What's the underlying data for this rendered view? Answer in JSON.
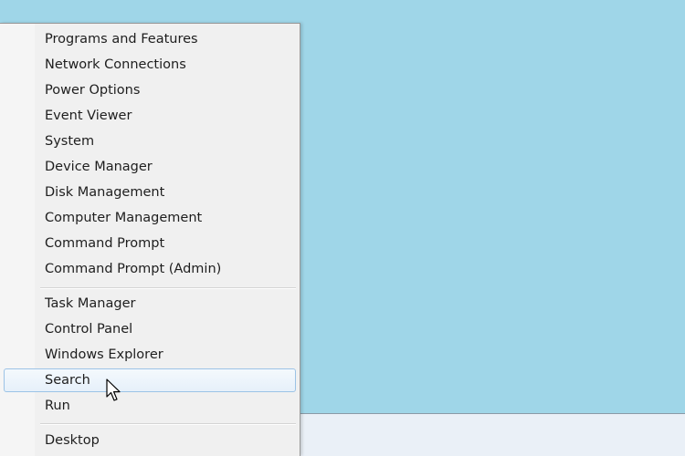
{
  "context_menu": {
    "groups": [
      {
        "items": [
          {
            "label": "Programs and Features"
          },
          {
            "label": "Network Connections"
          },
          {
            "label": "Power Options"
          },
          {
            "label": "Event Viewer"
          },
          {
            "label": "System"
          },
          {
            "label": "Device Manager"
          },
          {
            "label": "Disk Management"
          },
          {
            "label": "Computer Management"
          },
          {
            "label": "Command Prompt"
          },
          {
            "label": "Command Prompt (Admin)"
          }
        ]
      },
      {
        "items": [
          {
            "label": "Task Manager"
          },
          {
            "label": "Control Panel"
          },
          {
            "label": "Windows Explorer"
          },
          {
            "label": "Search"
          },
          {
            "label": "Run"
          }
        ]
      },
      {
        "items": [
          {
            "label": "Desktop"
          }
        ]
      }
    ],
    "highlighted_item": "Search"
  },
  "icons": {
    "cursor": "mouse-pointer-icon"
  },
  "colors": {
    "desktop": "#9fd6e8",
    "menu_background": "#f0f0f0",
    "highlight_border": "#9cc3e6",
    "taskbar": "#eaf0f7"
  }
}
